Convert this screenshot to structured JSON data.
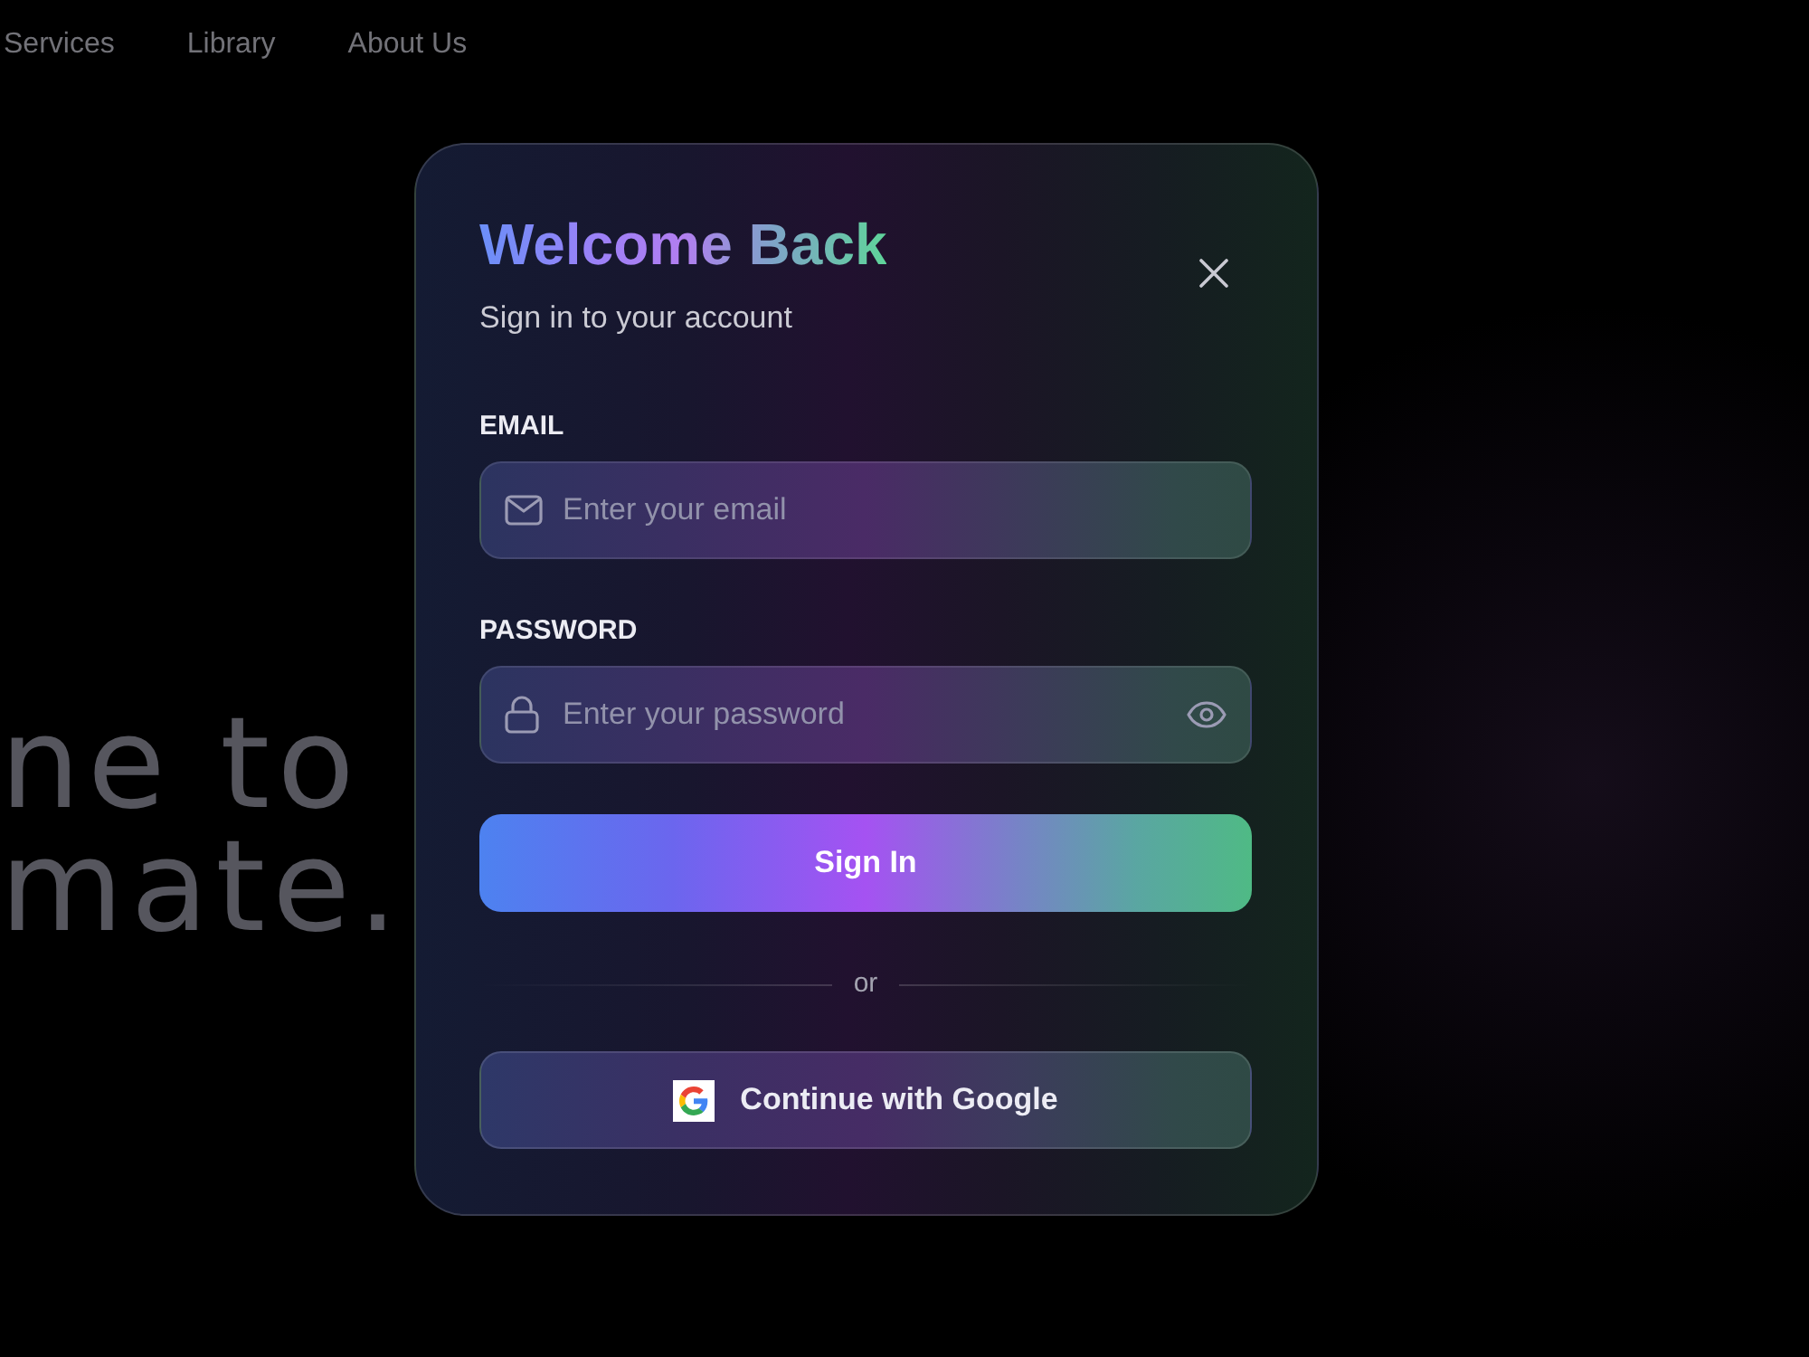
{
  "nav": {
    "links": [
      "Services",
      "Library",
      "About Us"
    ]
  },
  "hero": {
    "lines": [
      "ne to",
      "mate."
    ]
  },
  "dialog": {
    "title": "Welcome Back",
    "subtitle": "Sign in to your account",
    "fields": [
      {
        "kind": "email",
        "label": "EMAIL",
        "placeholder": "Enter your email"
      },
      {
        "kind": "password",
        "label": "PASSWORD",
        "placeholder": "Enter your password"
      }
    ],
    "submit_button": "Sign In",
    "divider": "or",
    "social_button": "Continue with Google"
  }
}
